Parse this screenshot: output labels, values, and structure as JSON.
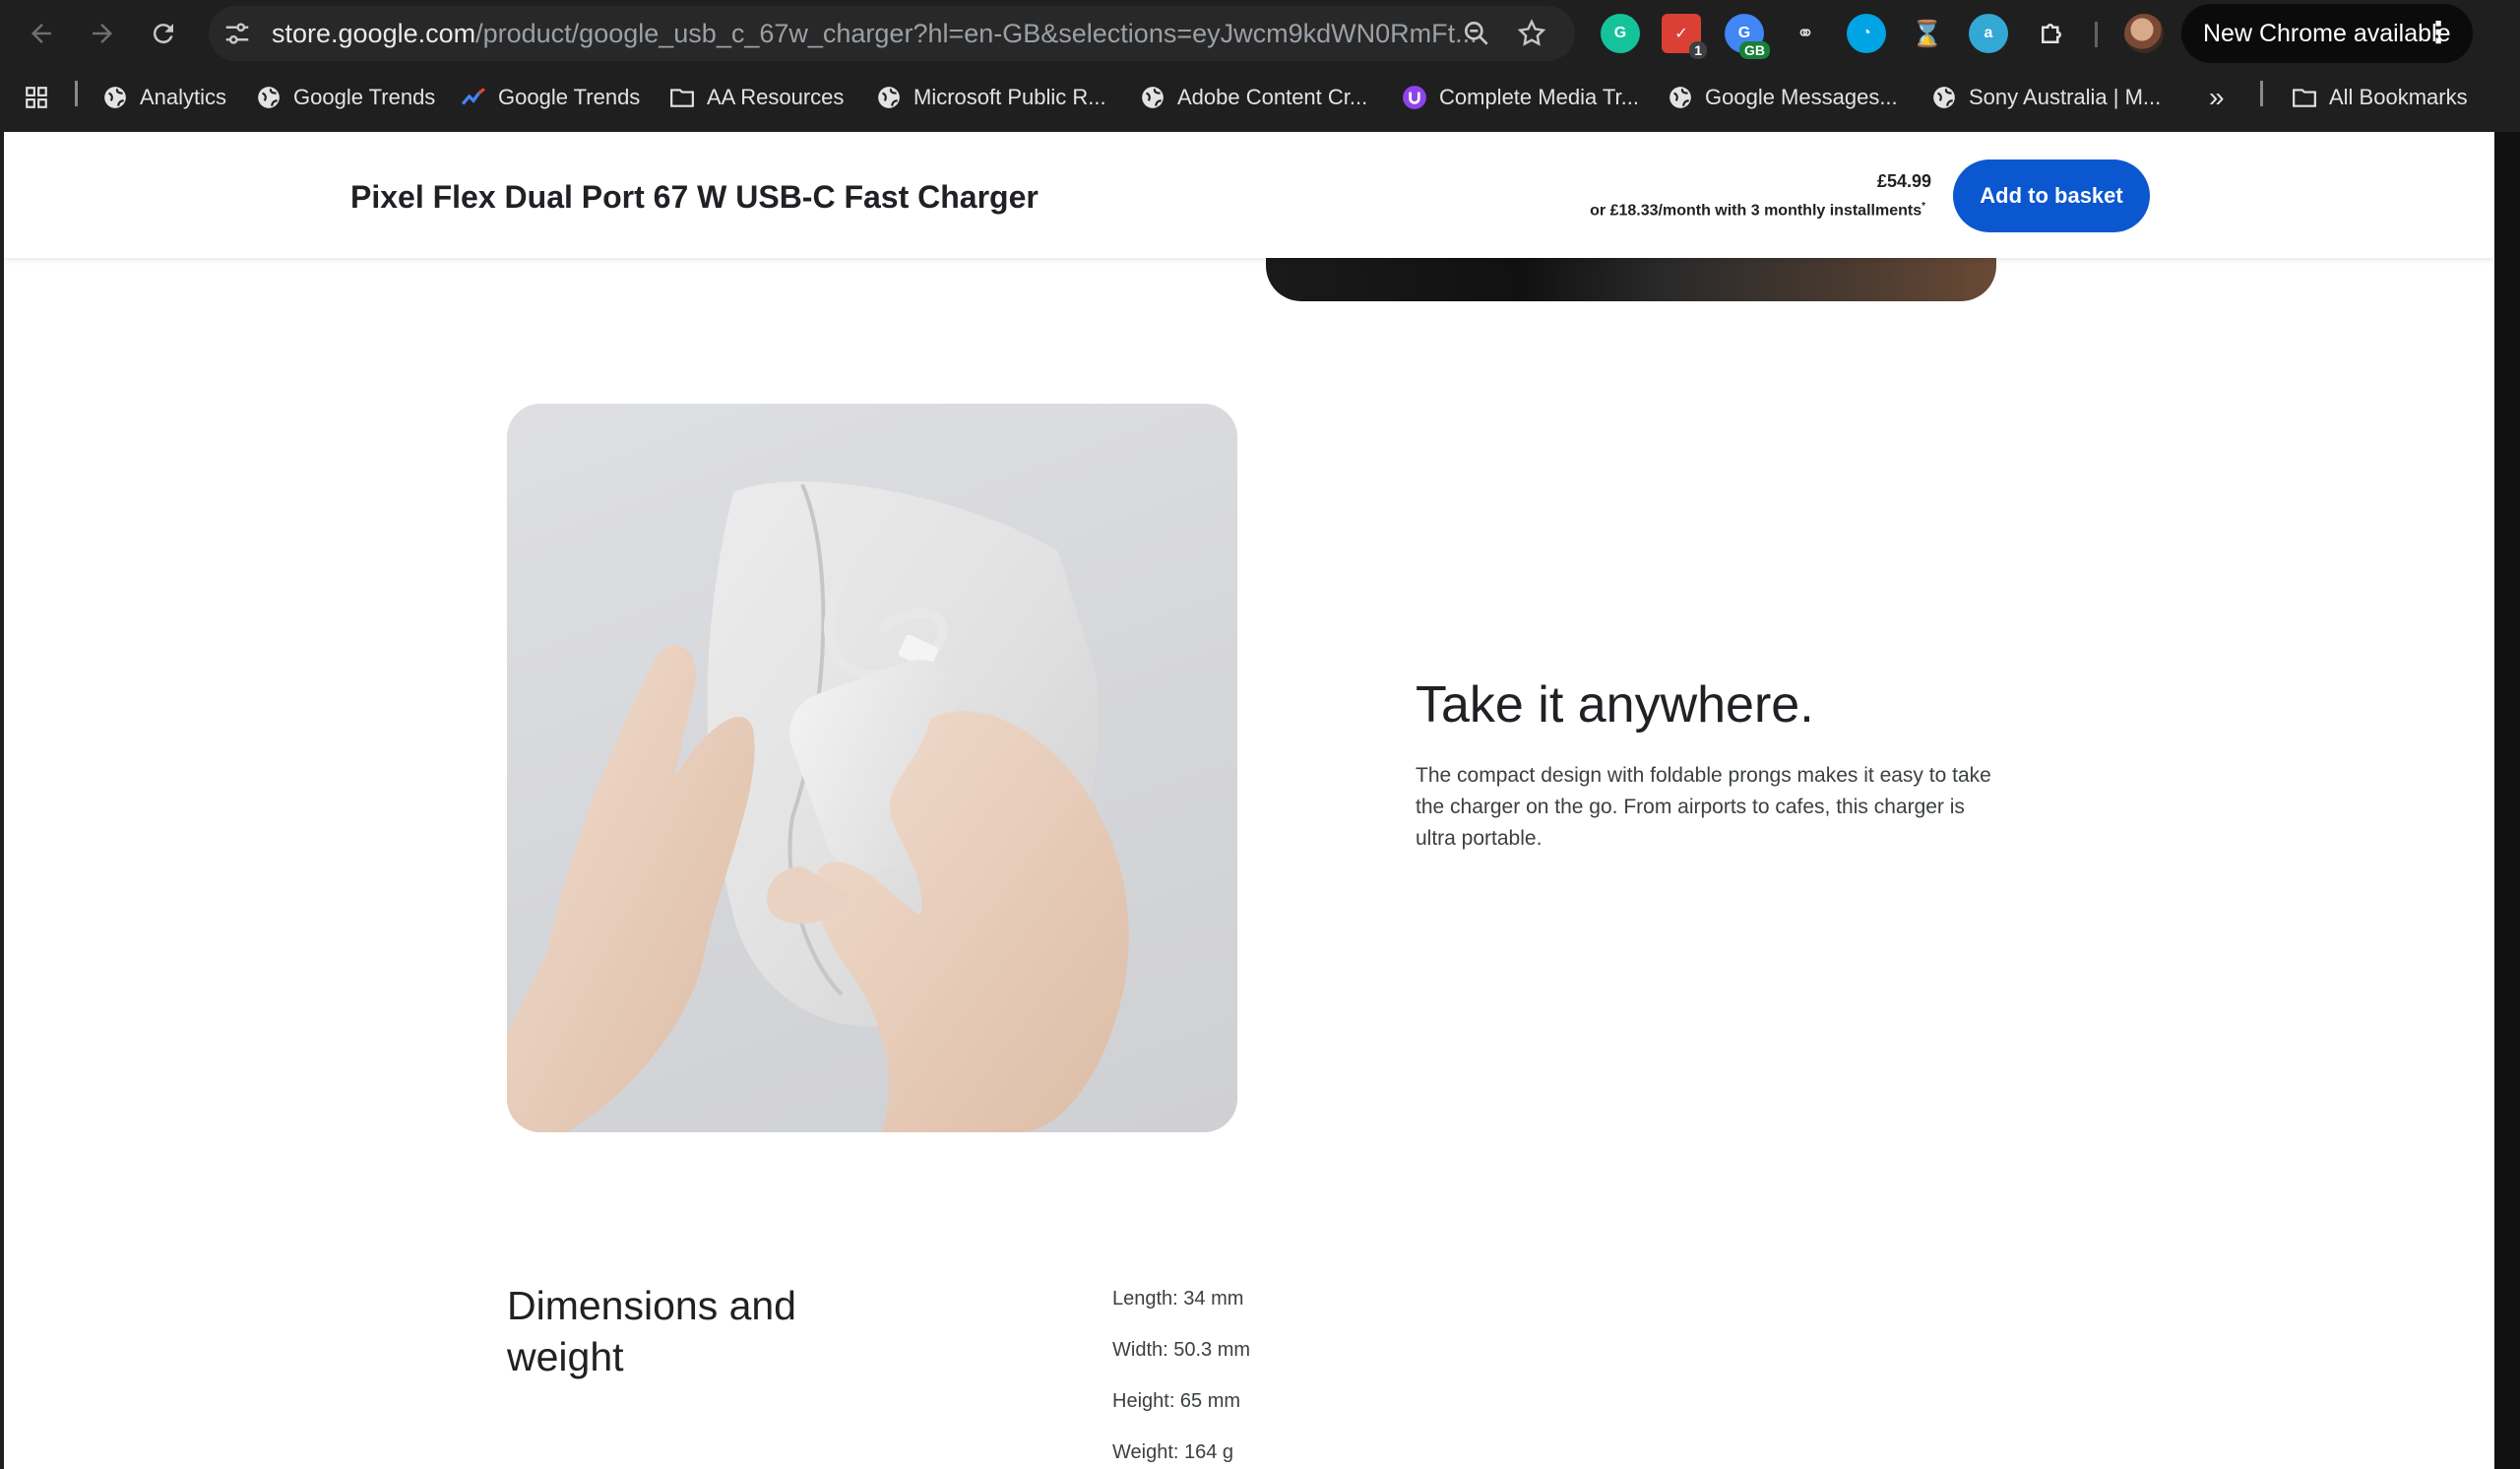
{
  "browser": {
    "url_host": "store.google.com",
    "url_path": "/product/google_usb_c_67w_charger?hl=en-GB&selections=eyJwcm9kdWN0RmFt...",
    "extensions": [
      {
        "name": "grammarly-extension",
        "color": "#15c39a"
      },
      {
        "name": "todoist-extension",
        "color": "#db4035",
        "badge": "1"
      },
      {
        "name": "translate-extension",
        "color": "#4285f4",
        "badge": "GB"
      },
      {
        "name": "link-extension",
        "color": "#e3e3e3"
      },
      {
        "name": "semrush-extension",
        "color": "#00a4e4"
      },
      {
        "name": "timer-extension",
        "color": "#f5b400"
      },
      {
        "name": "amazon-assistant-extension",
        "color": "#34a8d4"
      },
      {
        "name": "extensions-puzzle",
        "color": "#e3e3e3"
      }
    ],
    "update_button": "New Chrome available",
    "bookmarks": [
      {
        "label": "Analytics",
        "icon": "globe-icon"
      },
      {
        "label": "Google Trends",
        "icon": "globe-icon"
      },
      {
        "label": "Google Trends",
        "icon": "trends-icon"
      },
      {
        "label": "AA Resources",
        "icon": "folder-icon"
      },
      {
        "label": "Microsoft Public R...",
        "icon": "globe-icon"
      },
      {
        "label": "Adobe Content Cr...",
        "icon": "globe-icon"
      },
      {
        "label": "Complete Media Tr...",
        "icon": "u-icon"
      },
      {
        "label": "Google Messages...",
        "icon": "globe-icon"
      },
      {
        "label": "Sony Australia | M...",
        "icon": "globe-icon"
      }
    ],
    "all_bookmarks": "All Bookmarks"
  },
  "product_bar": {
    "title": "Pixel Flex Dual Port 67 W USB-C Fast Charger",
    "price": "£54.99",
    "installments": "or £18.33/month with 3 monthly installments",
    "installments_mark": "*",
    "add_to_basket": "Add to basket"
  },
  "feature": {
    "title": "Take it anywhere.",
    "body": "The compact design with foldable prongs makes it easy to take the charger on the go. From airports to cafes, this charger is ultra portable."
  },
  "dimensions": {
    "title": "Dimensions and weight",
    "specs": [
      "Length: 34 mm",
      "Width: 50.3 mm",
      "Height: 65 mm",
      "Weight: 164 g"
    ]
  }
}
